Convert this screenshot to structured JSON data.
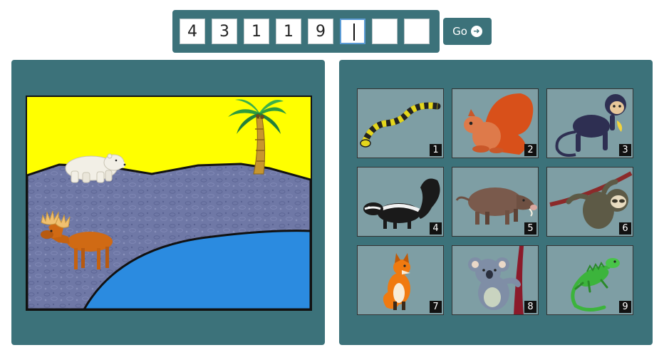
{
  "code_input": {
    "digits": [
      "4",
      "3",
      "1",
      "1",
      "9",
      "",
      "",
      ""
    ],
    "active_index": 5
  },
  "go_button": {
    "label": "Go",
    "icon": "arrow-right-circle-icon"
  },
  "scene": {
    "background": "#ffff00",
    "ground_color": "#6f78a6",
    "water_color": "#2b8be0",
    "animals": [
      "polar-bear",
      "palm-tree",
      "moose"
    ]
  },
  "choices": [
    {
      "number": "1",
      "animal": "snake"
    },
    {
      "number": "2",
      "animal": "squirrel"
    },
    {
      "number": "3",
      "animal": "monkey"
    },
    {
      "number": "4",
      "animal": "skunk"
    },
    {
      "number": "5",
      "animal": "wild-boar"
    },
    {
      "number": "6",
      "animal": "sloth"
    },
    {
      "number": "7",
      "animal": "fox"
    },
    {
      "number": "8",
      "animal": "koala"
    },
    {
      "number": "9",
      "animal": "iguana"
    }
  ],
  "colors": {
    "accent": "#3c727a",
    "tile_bg": "#7e9ea4",
    "active_border": "#5b9bd5"
  }
}
